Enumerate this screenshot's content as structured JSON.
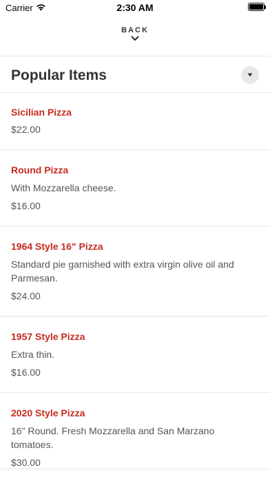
{
  "status_bar": {
    "carrier": "Carrier",
    "time": "2:30 AM",
    "battery_level": 1.0
  },
  "nav": {
    "back_label": "BACK"
  },
  "section": {
    "title": "Popular Items"
  },
  "colors": {
    "accent": "#c62b20",
    "text": "#555555",
    "title": "#333333"
  },
  "items": [
    {
      "name": "Sicilian Pizza",
      "description": "",
      "price": "$22.00"
    },
    {
      "name": "Round Pizza",
      "description": "With Mozzarella cheese.",
      "price": "$16.00"
    },
    {
      "name": "1964 Style 16\" Pizza",
      "description": "Standard pie garnished with extra virgin olive oil and Parmesan.",
      "price": "$24.00"
    },
    {
      "name": "1957 Style Pizza",
      "description": "Extra thin.",
      "price": "$16.00"
    },
    {
      "name": "2020 Style Pizza",
      "description": "16\" Round. Fresh Mozzarella and San Marzano tomatoes.",
      "price": "$30.00"
    }
  ]
}
